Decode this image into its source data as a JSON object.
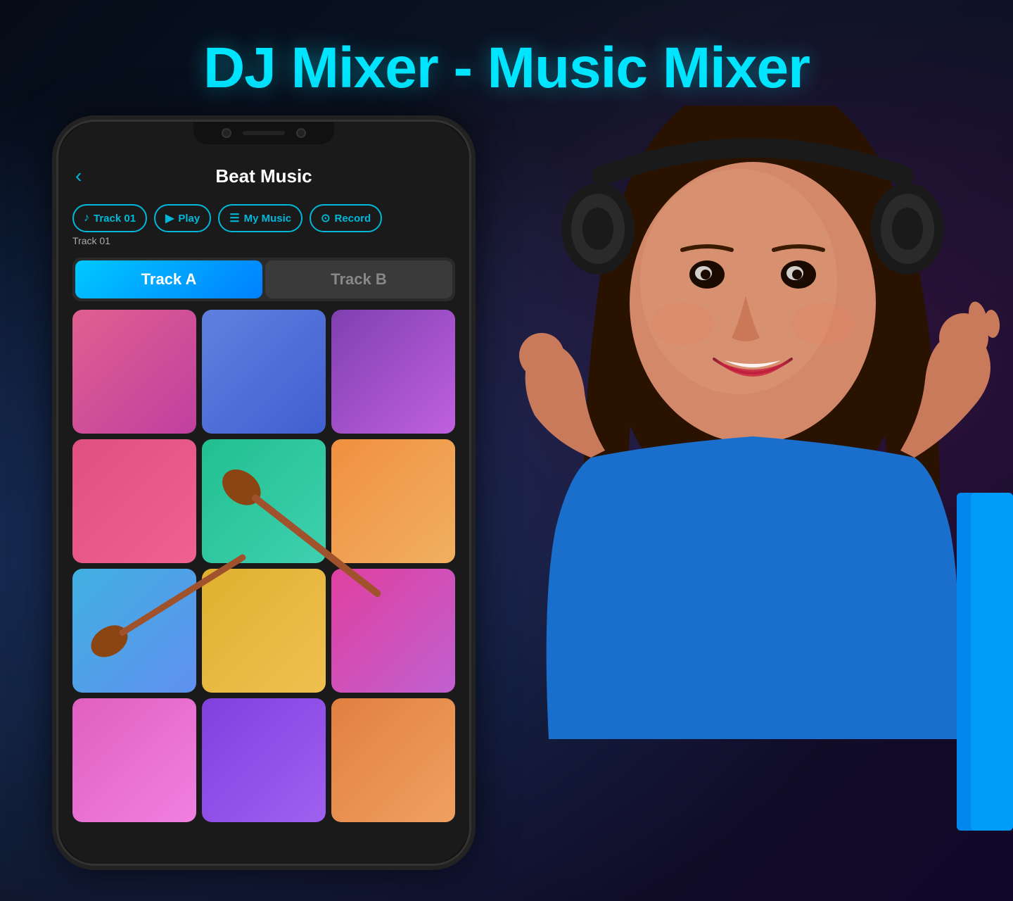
{
  "page": {
    "title": "DJ Mixer - Music Mixer",
    "background_color": "#0a0f1a"
  },
  "phone": {
    "app_title": "Beat Music",
    "back_button": "‹",
    "toolbar": {
      "track_btn": "Track 01",
      "play_btn": "Play",
      "my_music_btn": "My Music",
      "record_btn": "Record"
    },
    "track_label": "Track 01",
    "track_tabs": {
      "tab_a": "Track A",
      "tab_b": "Track B",
      "active": "A"
    },
    "pads": [
      {
        "id": 1,
        "class": "pad-1"
      },
      {
        "id": 2,
        "class": "pad-2"
      },
      {
        "id": 3,
        "class": "pad-3"
      },
      {
        "id": 4,
        "class": "pad-4"
      },
      {
        "id": 5,
        "class": "pad-5"
      },
      {
        "id": 6,
        "class": "pad-6"
      },
      {
        "id": 7,
        "class": "pad-7"
      },
      {
        "id": 8,
        "class": "pad-8"
      },
      {
        "id": 9,
        "class": "pad-9"
      },
      {
        "id": 10,
        "class": "pad-10"
      },
      {
        "id": 11,
        "class": "pad-11"
      },
      {
        "id": 12,
        "class": "pad-12"
      }
    ]
  },
  "track_section_label": "Track",
  "icons": {
    "back": "‹",
    "music_note": "♪",
    "play": "▶",
    "my_music": "☰",
    "record": "⊙"
  }
}
